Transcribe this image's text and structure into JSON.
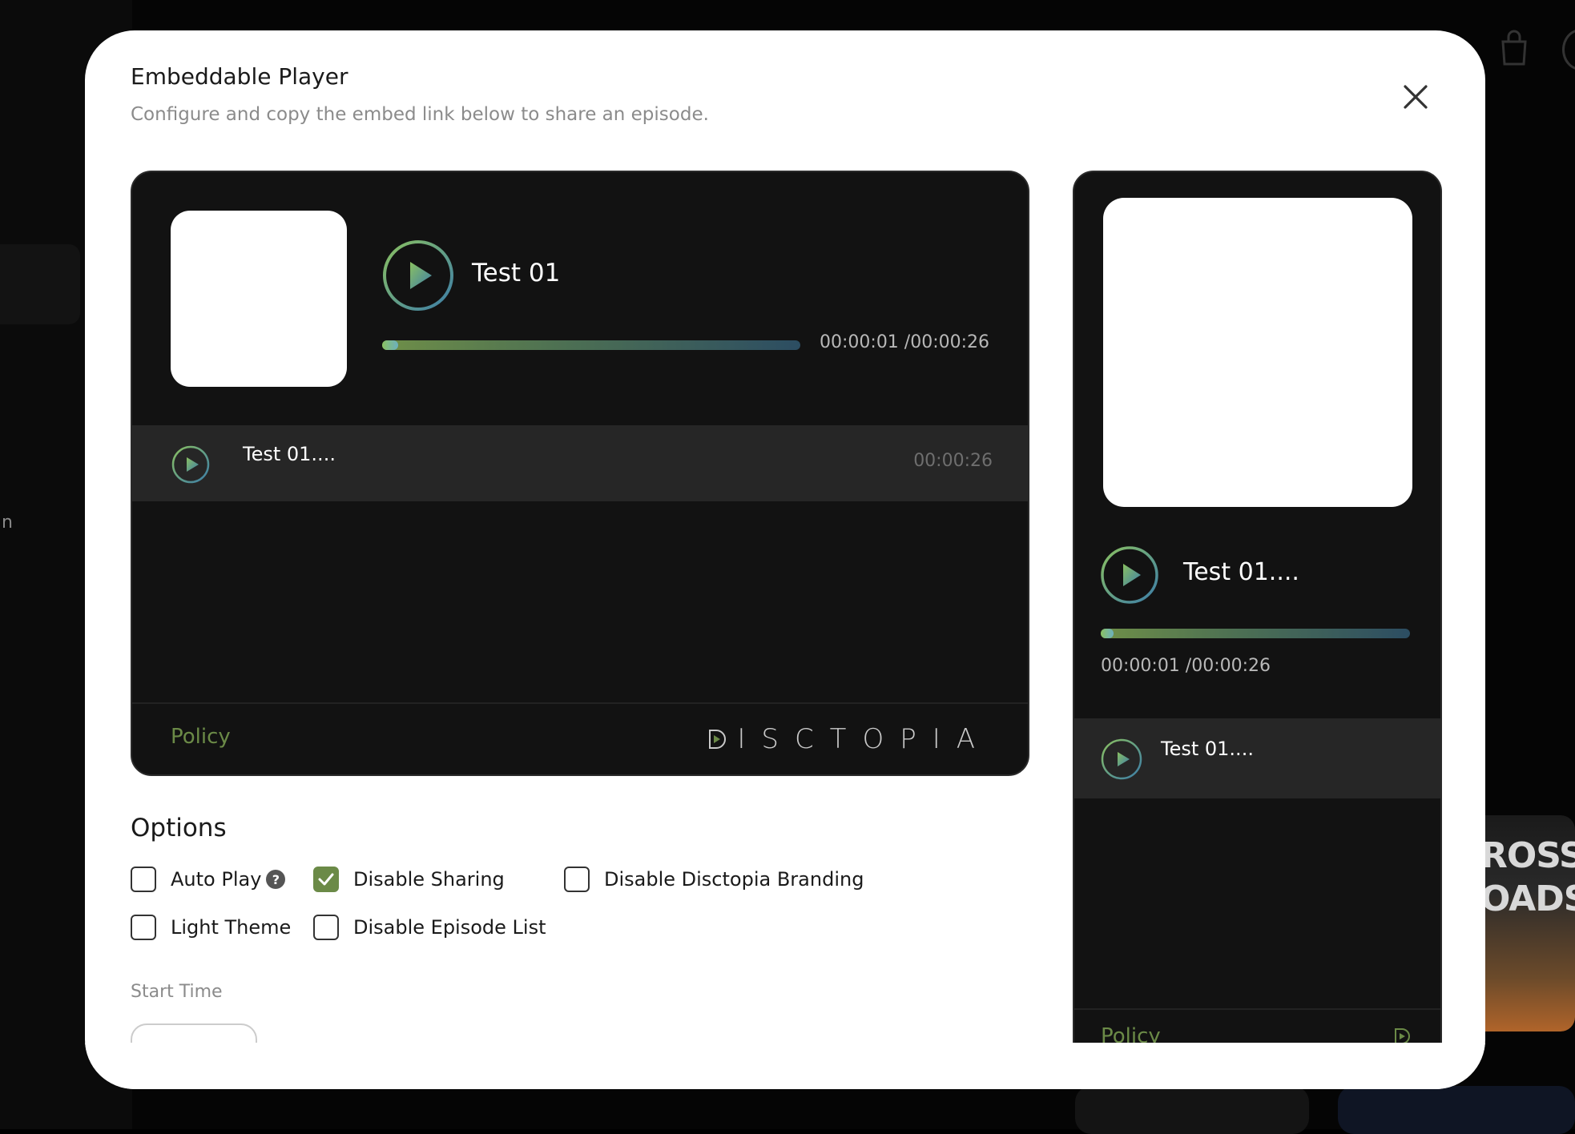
{
  "modal": {
    "title": "Embeddable Player",
    "subtitle": "Configure and copy the embed link below to share an episode.",
    "close_icon": "close-icon"
  },
  "player_large": {
    "title": "Test 01",
    "progress": 0.04,
    "time": "00:00:01 /00:00:26",
    "episode": {
      "title": "Test 01....",
      "duration": "00:00:26"
    },
    "policy": "Policy",
    "brand": "ISCTOPIA"
  },
  "player_small": {
    "title": "Test 01....",
    "progress": 0.04,
    "time": "00:00:01 /00:00:26",
    "episode": {
      "title": "Test 01...."
    },
    "policy": "Policy"
  },
  "options": {
    "title": "Options",
    "items": [
      {
        "label": "Auto Play",
        "checked": false
      },
      {
        "label": "Disable Sharing",
        "checked": true
      },
      {
        "label": "Disable Disctopia Branding",
        "checked": false
      },
      {
        "label": "Light Theme",
        "checked": false
      },
      {
        "label": "Disable Episode List",
        "checked": false
      }
    ],
    "start_time_label": "Start Time"
  },
  "background": {
    "left_text": "n",
    "poster_text": "ROSS\nOADS"
  },
  "colors": {
    "accent": "#6b8a47",
    "player_bg": "#121212",
    "row_bg": "#262626"
  }
}
